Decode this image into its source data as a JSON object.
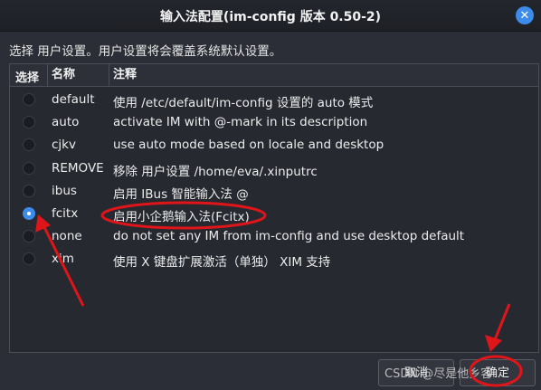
{
  "window": {
    "title": "输入法配置(im-config 版本 0.50-2)",
    "close_icon": "✕"
  },
  "instruction": "选择 用户设置。用户设置将会覆盖系统默认设置。",
  "table": {
    "headers": [
      "选择",
      "名称",
      "注释"
    ],
    "rows": [
      {
        "selected": false,
        "name": "default",
        "desc": "使用 /etc/default/im-config 设置的 auto 模式"
      },
      {
        "selected": false,
        "name": "auto",
        "desc": "activate IM with @-mark in its description"
      },
      {
        "selected": false,
        "name": "cjkv",
        "desc": "use auto mode based on locale and desktop"
      },
      {
        "selected": false,
        "name": "REMOVE",
        "desc": "移除 用户设置 /home/eva/.xinputrc"
      },
      {
        "selected": false,
        "name": "ibus",
        "desc": "启用 IBus 智能输入法 @"
      },
      {
        "selected": true,
        "name": "fcitx",
        "desc": "启用小企鹅输入法(Fcitx)"
      },
      {
        "selected": false,
        "name": "none",
        "desc": "do not set any IM from im-config and use desktop default"
      },
      {
        "selected": false,
        "name": "xim",
        "desc": "使用 X 键盘扩展激活（单独） XIM 支持"
      }
    ]
  },
  "buttons": {
    "cancel": "取消",
    "ok": "确定"
  },
  "watermark": "CSDN @尽是他乡客",
  "colors": {
    "accent": "#3d8bea",
    "annotation": "#e0151a"
  }
}
